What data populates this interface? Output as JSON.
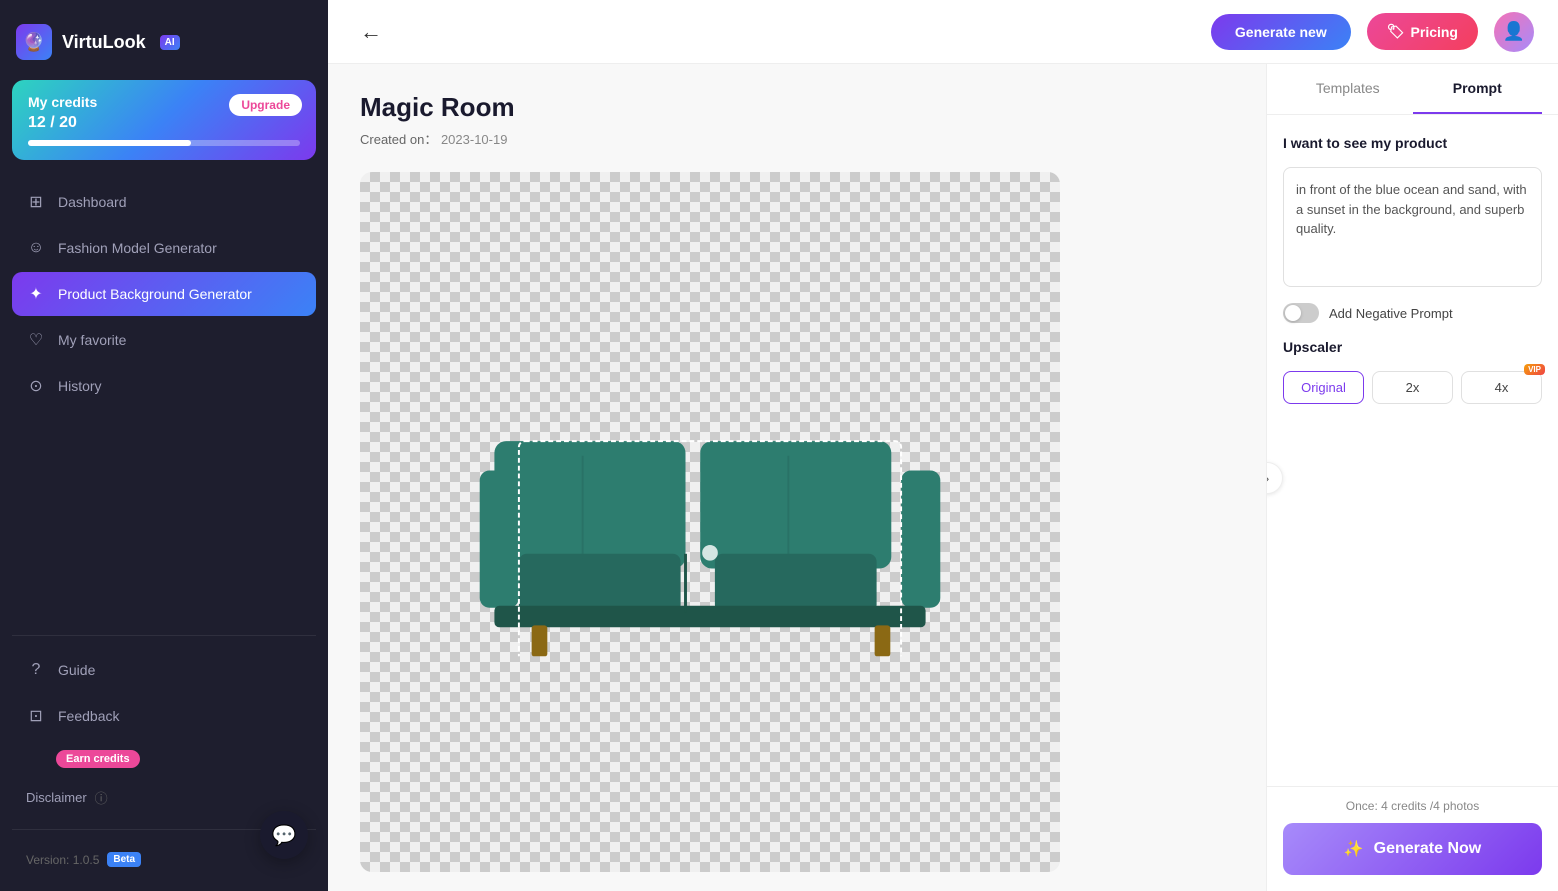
{
  "app": {
    "name": "VirtuLook",
    "badge": "AI"
  },
  "credits": {
    "label": "My credits",
    "current": 12,
    "max": 20,
    "display": "12 / 20",
    "fill_percent": 60,
    "upgrade_label": "Upgrade"
  },
  "sidebar": {
    "nav_items": [
      {
        "id": "dashboard",
        "label": "Dashboard",
        "icon": "⊞",
        "active": false
      },
      {
        "id": "fashion-model",
        "label": "Fashion Model Generator",
        "icon": "☺",
        "active": false
      },
      {
        "id": "product-bg",
        "label": "Product Background Generator",
        "icon": "✦",
        "active": true
      },
      {
        "id": "my-favorite",
        "label": "My favorite",
        "icon": "♡",
        "active": false
      },
      {
        "id": "history",
        "label": "History",
        "icon": "⊙",
        "active": false
      }
    ],
    "bottom_items": [
      {
        "id": "guide",
        "label": "Guide",
        "icon": "?"
      },
      {
        "id": "feedback",
        "label": "Feedback",
        "icon": "⊡"
      }
    ],
    "earn_credits_label": "Earn credits",
    "disclaimer_label": "Disclaimer",
    "version_label": "Version: 1.0.5",
    "version_badge": "Beta"
  },
  "topbar": {
    "generate_new_label": "Generate new",
    "pricing_label": "Pricing",
    "pricing_icon": "🏷"
  },
  "page": {
    "title": "Magic Room",
    "created_label": "Created on：",
    "created_date": "2023-10-19"
  },
  "right_panel": {
    "tab_templates": "Templates",
    "tab_prompt": "Prompt",
    "active_tab": "prompt",
    "prompt_section_label": "I want to see my product",
    "prompt_text": "in front of the blue ocean and sand, with a sunset in the background, and superb quality.",
    "negative_prompt_label": "Add Negative Prompt",
    "upscaler_label": "Upscaler",
    "upscaler_options": [
      {
        "id": "original",
        "label": "Original",
        "active": true,
        "vip": false
      },
      {
        "id": "2x",
        "label": "2x",
        "active": false,
        "vip": false
      },
      {
        "id": "4x",
        "label": "4x",
        "active": false,
        "vip": true
      }
    ],
    "credits_info": "Once: 4 credits /4 photos",
    "generate_btn_label": "Generate Now",
    "chevron_icon": "›"
  }
}
